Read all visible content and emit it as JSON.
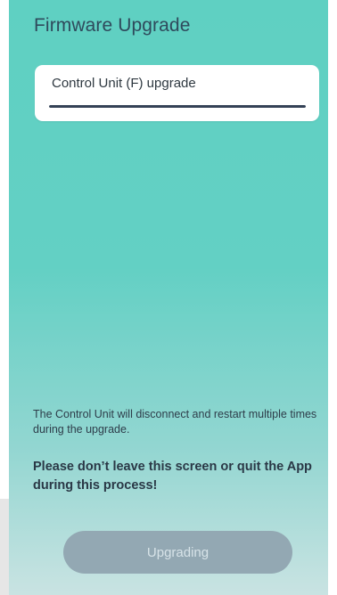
{
  "header": {
    "title": "Firmware Upgrade"
  },
  "upgrade_card": {
    "label": "Control Unit (F) upgrade",
    "progress": 1.0
  },
  "info": {
    "message": "The Control Unit will disconnect and restart multiple times during the upgrade."
  },
  "warning": {
    "message": "Please don’t leave this screen or quit the App during this process!"
  },
  "actions": {
    "button_label": "Upgrading",
    "button_enabled": false
  },
  "colors": {
    "background_top": "#5fd0c2",
    "background_bottom": "#c9e3e2",
    "progress_fill": "#344256",
    "button_disabled": "#93a8b3"
  }
}
